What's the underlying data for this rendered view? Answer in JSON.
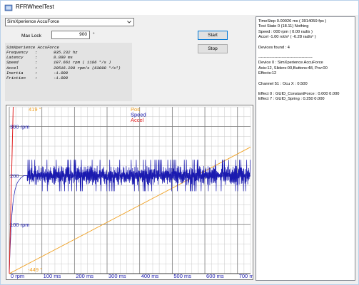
{
  "window": {
    "title": "RFRWheelTest"
  },
  "device_select": {
    "value": "SimXperience AccuForce"
  },
  "max_lock": {
    "label": "Max Lock",
    "value": "900",
    "unit": "°"
  },
  "buttons": {
    "start": "Start",
    "stop": "Stop"
  },
  "info": {
    "title": "SimXperience AccuForce",
    "rows": [
      {
        "key": "Frequency",
        "value": "935.232 hz"
      },
      {
        "key": "Latency",
        "value": "8.880 ms"
      },
      {
        "key": "Speed",
        "value": "197.661 rpm   ( 1186 °/s )"
      },
      {
        "key": "Accel",
        "value": "20516.289 rpm/s (63098 °/s²)"
      },
      {
        "key": "Inertia",
        "value": "-1.000"
      },
      {
        "key": "Friction",
        "value": "-1.000"
      }
    ]
  },
  "status": {
    "lines": [
      "TimeStep 0.00026 ms ( 3914059 fps )",
      "Test State 0 (18.11) Nothing",
      "Speed : 000 rpm ( 0.00 rad/s )",
      " Accel -1.00 rot/s² ( -6.28 rad/s² )",
      "",
      "Devices found : 4",
      "",
      "----------------------------------------",
      "Device 0 : SimXperience AccuForce",
      "Axis:12, Sliders:00,Buttons:48, Pov:00",
      "Effects:12",
      "",
      "Channel 51 : Ocu X : 0.500",
      "",
      "Effect 0 : GUID_ConstantForce : 0.000 0.000",
      "Effect 7 : GUID_Spring : 0.250 0.000"
    ]
  },
  "chart_data": {
    "type": "line",
    "x_unit": "ms",
    "x_tick_labels": [
      "0 rpm",
      "100 ms",
      "200 ms",
      "300 ms",
      "400 ms",
      "500 ms",
      "600 ms",
      "700 ms"
    ],
    "x_ticks": [
      0,
      100,
      200,
      300,
      400,
      500,
      600,
      700
    ],
    "xlim": [
      0,
      740
    ],
    "y_tick_labels": [
      "300 rpm",
      "200",
      "100 rpm"
    ],
    "y_ticks": [
      300,
      200,
      100
    ],
    "ylim": [
      0,
      340
    ],
    "annotations": {
      "pos_top": "419 °",
      "pos_bottom": "-449 °"
    },
    "legend_position": "top-center",
    "series": [
      {
        "name": "Pos",
        "color": "#f0a020",
        "x": [
          0,
          740
        ],
        "y": [
          0,
          258
        ]
      },
      {
        "name": "Speed",
        "color": "#1a1ab0",
        "steady_value": 200,
        "ripple": 20,
        "rise_x": [
          0,
          2,
          5,
          8,
          12,
          18,
          25,
          35,
          45,
          55
        ],
        "rise_y": [
          0,
          40,
          85,
          120,
          150,
          172,
          186,
          195,
          200,
          200
        ]
      },
      {
        "name": "Accel",
        "color": "#e02020",
        "x": [
          0,
          12
        ],
        "y": [
          0,
          340
        ]
      }
    ],
    "grid": true,
    "colors": {
      "grid_major": "#808080",
      "grid_minor": "#c8c8c8",
      "axis_text": "#1a1ab0",
      "pos_text": "#f0a020"
    }
  }
}
